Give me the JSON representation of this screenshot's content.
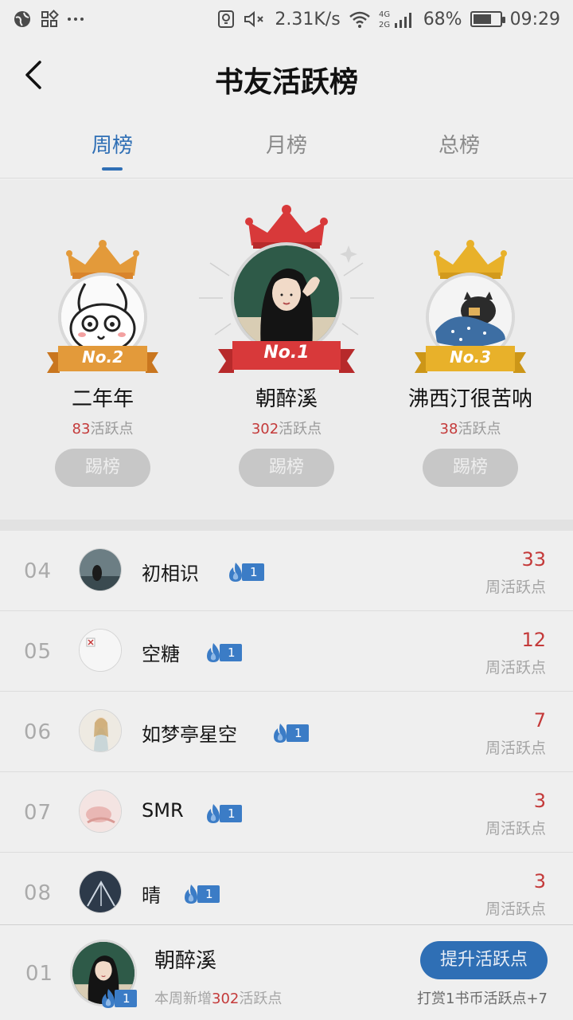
{
  "status_bar": {
    "speed": "2.31K/s",
    "network": "4G 2G",
    "battery": "68%",
    "battery_level": 0.68,
    "time": "09:29"
  },
  "header": {
    "title": "书友活跃榜",
    "back_icon": "chevron-left-icon"
  },
  "tabs": [
    {
      "label": "周榜",
      "active": true
    },
    {
      "label": "月榜",
      "active": false
    },
    {
      "label": "总榜",
      "active": false
    }
  ],
  "podium": {
    "first": {
      "badge": "No.1",
      "name": "朝醉溪",
      "points": "302",
      "points_suffix": "活跃点",
      "button": "踢榜"
    },
    "second": {
      "badge": "No.2",
      "name": "二年年",
      "points": "83",
      "points_suffix": "活跃点",
      "button": "踢榜"
    },
    "third": {
      "badge": "No.3",
      "name": "沸西汀很苦呐",
      "points": "38",
      "points_suffix": "活跃点",
      "button": "踢榜"
    }
  },
  "list": [
    {
      "rank": "04",
      "name": "初相识",
      "level": "1",
      "score": "33",
      "sub": "周活跃点"
    },
    {
      "rank": "05",
      "name": "空糖",
      "level": "1",
      "score": "12",
      "sub": "周活跃点"
    },
    {
      "rank": "06",
      "name": "如梦亭星空",
      "level": "1",
      "score": "7",
      "sub": "周活跃点"
    },
    {
      "rank": "07",
      "name": "SMR",
      "level": "1",
      "score": "3",
      "sub": "周活跃点"
    },
    {
      "rank": "08",
      "name": "晴",
      "level": "1",
      "score": "3",
      "sub": "周活跃点"
    }
  ],
  "me": {
    "rank": "01",
    "name": "朝醉溪",
    "level": "1",
    "note_prefix": "本周新增",
    "note_num": "302",
    "note_suffix": "活跃点",
    "boost_button": "提升活跃点",
    "reward_note": "打赏1书币活跃点+7"
  },
  "colors": {
    "accent": "#2f6fb5",
    "score_red": "#c43a3a",
    "gold": "#e2a233",
    "crown_red": "#d8393a"
  }
}
